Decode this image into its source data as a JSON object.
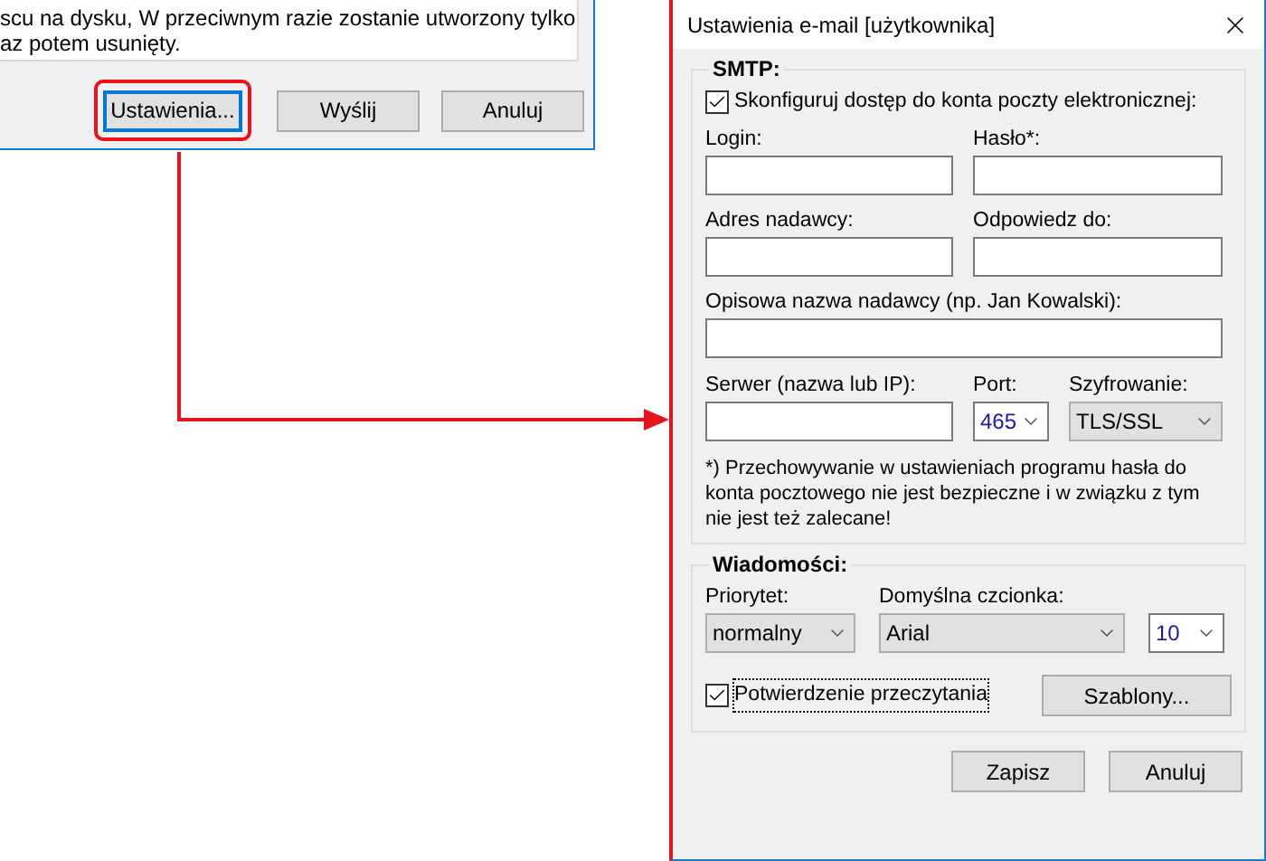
{
  "back_dialog": {
    "text_lines": [
      "scu na dysku, W przeciwnym razie zostanie utworzony tylko",
      "az potem usunięty."
    ],
    "buttons": [
      {
        "label": "Ustawienia...",
        "focused": true,
        "highlighted": true
      },
      {
        "label": "Wyślij",
        "focused": false,
        "highlighted": false
      },
      {
        "label": "Anuluj",
        "focused": false,
        "highlighted": false
      }
    ]
  },
  "dialog": {
    "title": "Ustawienia e-mail [użytkownika]",
    "smtp": {
      "legend": "SMTP:",
      "configure": {
        "label": "Skonfiguruj dostęp do konta poczty elektronicznej:",
        "checked": true
      },
      "login": {
        "label": "Login:"
      },
      "password": {
        "label": "Hasło*:"
      },
      "sender": {
        "label": "Adres nadawcy:"
      },
      "reply_to": {
        "label": "Odpowiedz do:"
      },
      "sender_name": {
        "label": "Opisowa nazwa nadawcy (np. Jan Kowalski):"
      },
      "server": {
        "label": "Serwer (nazwa lub IP):"
      },
      "port": {
        "label": "Port:",
        "value": "465",
        "kind": "combo"
      },
      "encryption": {
        "label": "Szyfrowanie:",
        "value": "TLS/SSL",
        "kind": "list"
      },
      "note": "*) Przechowywanie w ustawieniach programu hasła do konta pocztowego nie jest bezpieczne i w związku z tym nie jest też zalecane!"
    },
    "messages": {
      "legend": "Wiadomości:",
      "priority": {
        "label": "Priorytet:",
        "value": "normalny",
        "kind": "list"
      },
      "font": {
        "label": "Domyślna czcionka:",
        "value": "Arial",
        "kind": "list"
      },
      "size": {
        "value": "10",
        "kind": "combo"
      },
      "read_receipt": {
        "label": "Potwierdzenie przeczytania",
        "checked": true
      },
      "templates_button": "Szablony..."
    },
    "buttons": [
      "Zapisz",
      "Anuluj"
    ]
  }
}
